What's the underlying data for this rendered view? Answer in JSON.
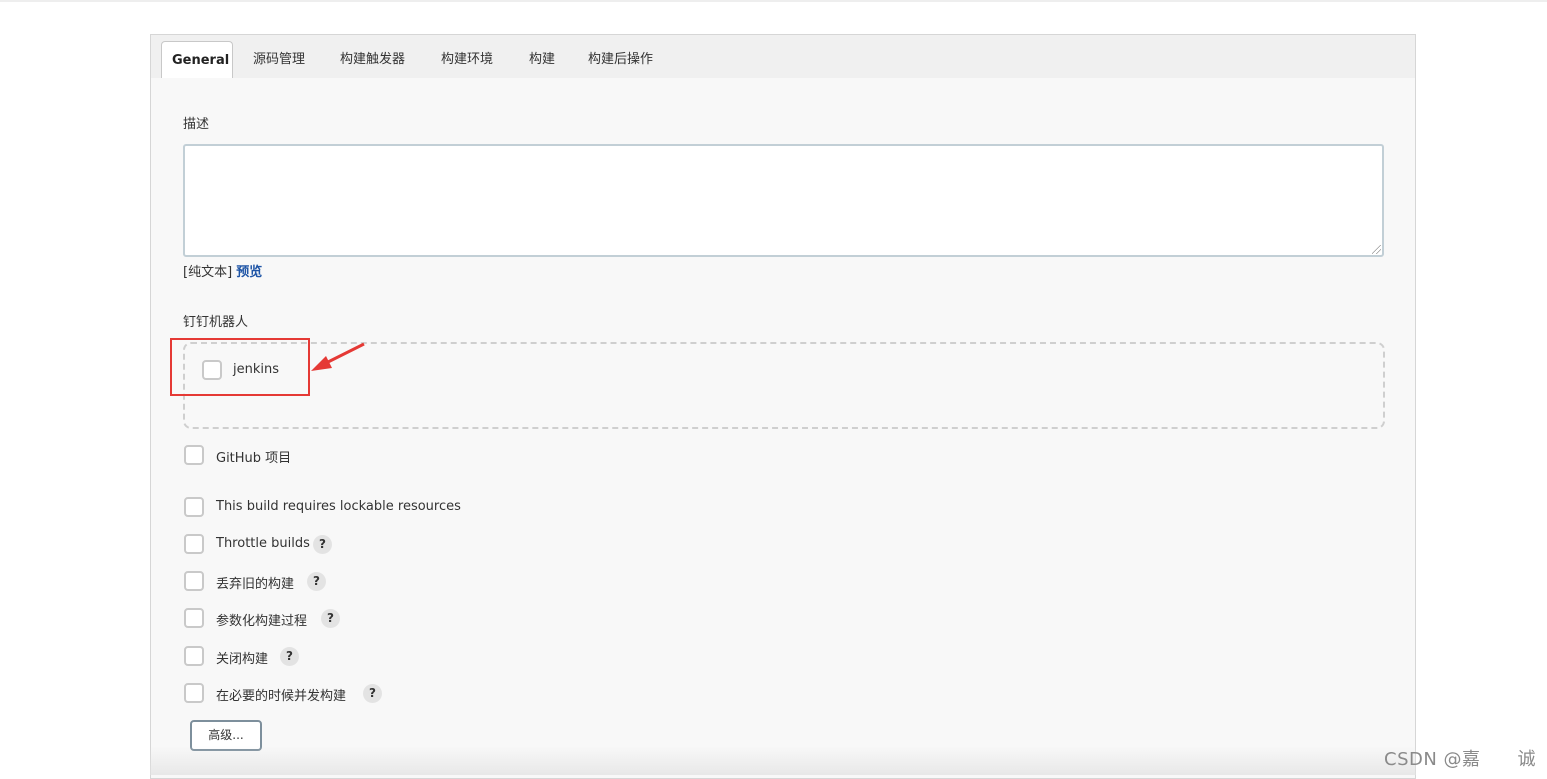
{
  "tabs": [
    "General",
    "源码管理",
    "构建触发器",
    "构建环境",
    "构建",
    "构建后操作"
  ],
  "description": {
    "label": "描述",
    "value": "",
    "format_note": "[纯文本]",
    "preview_link": "预览"
  },
  "dingtalk": {
    "label": "钉钉机器人",
    "robot_name": "jenkins"
  },
  "options": [
    {
      "label": "GitHub 项目",
      "checked": false,
      "help": ""
    },
    {
      "label": "This build requires lockable resources",
      "checked": false,
      "help": ""
    },
    {
      "label": "Throttle builds",
      "checked": false,
      "help": "?"
    },
    {
      "label": "丢弃旧的构建",
      "checked": false,
      "help": "?"
    },
    {
      "label": "参数化构建过程",
      "checked": false,
      "help": "?"
    },
    {
      "label": "关闭构建",
      "checked": false,
      "help": "?"
    },
    {
      "label": "在必要的时候并发构建",
      "checked": false,
      "help": "?"
    }
  ],
  "advanced_button": "高级...",
  "watermark": "CSDN @嘉　　诚",
  "colors": {
    "annotation_red": "#e53935",
    "link_blue": "#1f55a6"
  }
}
